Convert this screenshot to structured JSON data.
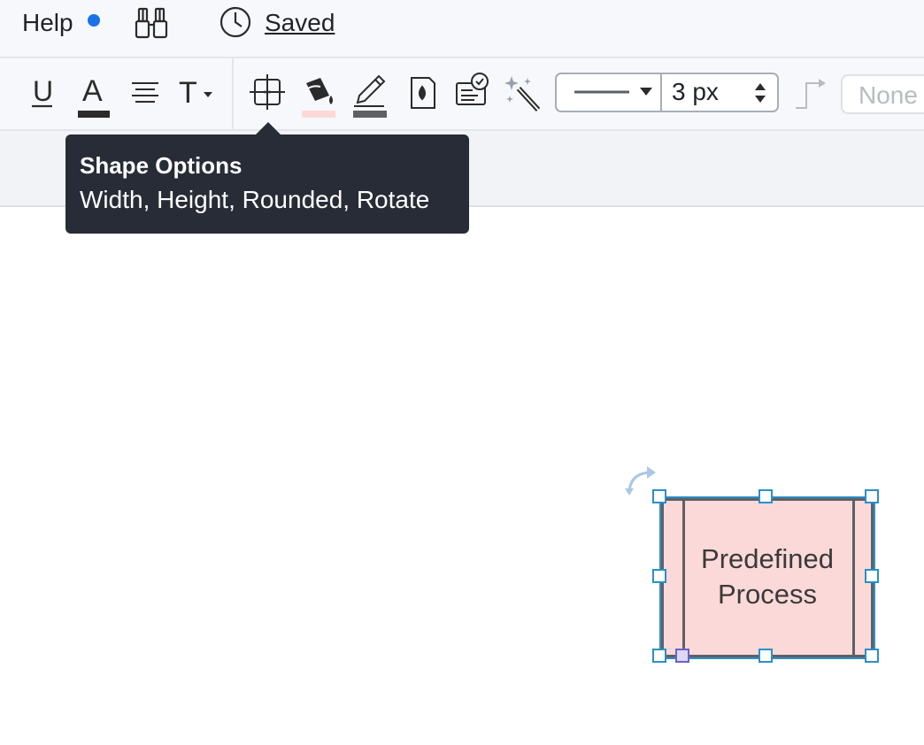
{
  "topbar": {
    "help_label": "Help",
    "saved_label": "Saved",
    "icons": [
      "binoculars-icon",
      "clock-icon"
    ]
  },
  "toolbar": {
    "buttons": [
      "underline-icon",
      "text-color-icon",
      "align-icon",
      "text-style-icon",
      "shape-options-icon",
      "fill-color-icon",
      "line-color-icon",
      "opacity-icon",
      "data-icon",
      "magic-icon"
    ],
    "underline_label": "U",
    "text_color_label": "A",
    "text_style_label": "T",
    "line_width_value": "3 px",
    "endpoint_value": "None",
    "fill_color": "#fcd9d9",
    "line_color": "#5f6064",
    "text_color": "#2b2b2b"
  },
  "tooltip": {
    "title": "Shape Options",
    "description": "Width, Height, Rounded, Rotate"
  },
  "canvas": {
    "shape_label": "Predefined Process",
    "selection_color": "#2b8fc9"
  }
}
